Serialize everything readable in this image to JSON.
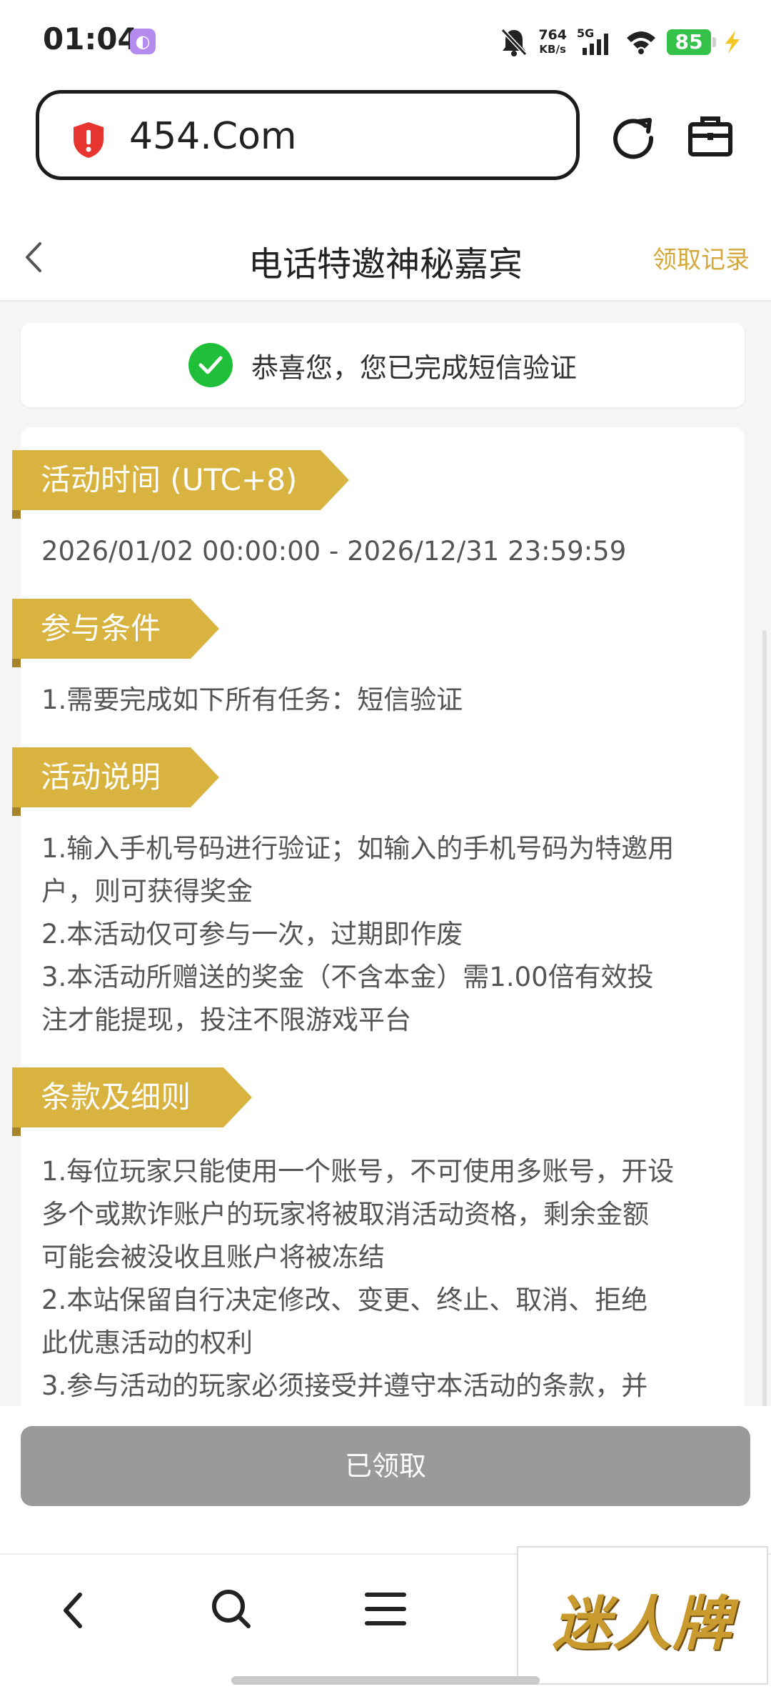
{
  "status_bar": {
    "time": "01:04",
    "speed_value": "764",
    "speed_unit": "KB/s",
    "network": "5G",
    "battery": "85"
  },
  "browser": {
    "url": "454.Com"
  },
  "header": {
    "title": "电话特邀神秘嘉宾",
    "records_link": "领取记录"
  },
  "notice": {
    "text": "恭喜您，您已完成短信验证"
  },
  "sections": {
    "time": {
      "title": "活动时间 (UTC+8)",
      "lines": [
        "2026/01/02 00:00:00 - 2026/12/31 23:59:59"
      ]
    },
    "conditions": {
      "title": "参与条件",
      "lines": [
        "1.需要完成如下所有任务：短信验证"
      ]
    },
    "description": {
      "title": "活动说明",
      "lines": [
        "1.输入手机号码进行验证；如输入的手机号码为特邀用",
        "户，则可获得奖金",
        "2.本活动仅可参与一次，过期即作废",
        "3.本活动所赠送的奖金（不含本金）需1.00倍有效投",
        "注才能提现，投注不限游戏平台"
      ]
    },
    "terms": {
      "title": "条款及细则",
      "lines": [
        "1.每位玩家只能使用一个账号，不可使用多账号，开设",
        "多个或欺诈账户的玩家将被取消活动资格，剩余金额",
        "可能会被没收且账户将被冻结",
        "2.本站保留自行决定修改、变更、终止、取消、拒绝",
        "此优惠活动的权利",
        "3.参与活动的玩家必须接受并遵守本活动的条款，并"
      ]
    }
  },
  "action": {
    "button_label": "已领取"
  },
  "ad": {
    "text": "迷人牌"
  },
  "colors": {
    "accent_gold": "#d9b33f",
    "success_green": "#1fbf3a",
    "disabled_gray": "#9a9a9a",
    "battery_green": "#35c24a"
  }
}
